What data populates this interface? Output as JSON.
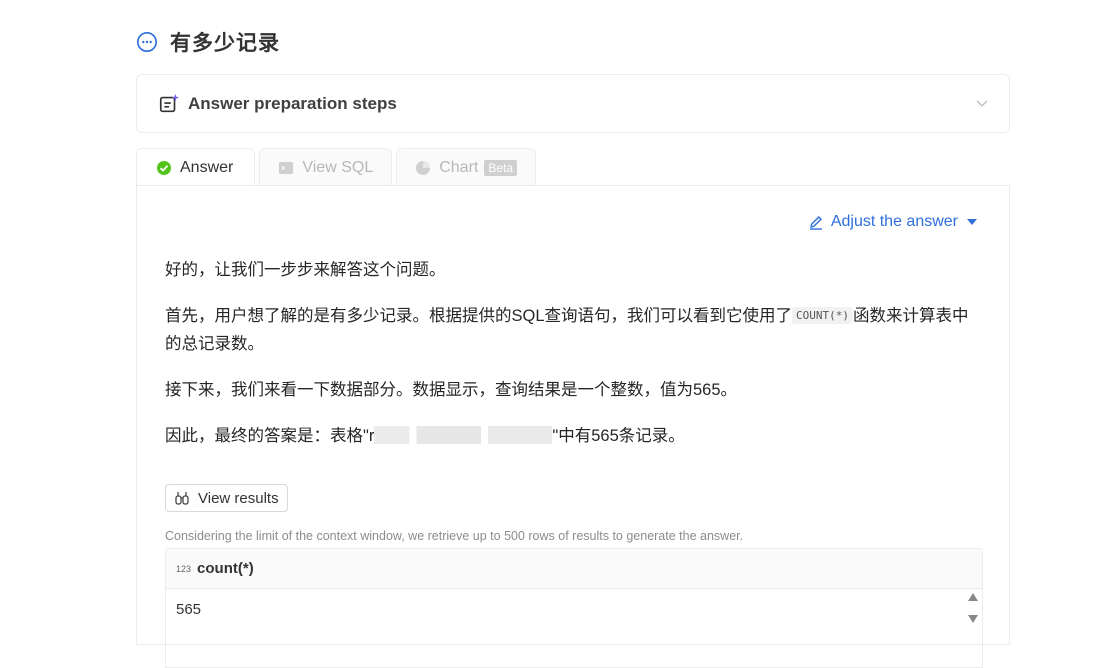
{
  "question": {
    "title": "有多少记录"
  },
  "steps": {
    "label": "Answer preparation steps"
  },
  "tabs": [
    {
      "label": "Answer",
      "icon": "check-circle-icon",
      "active": true
    },
    {
      "label": "View SQL",
      "icon": "terminal-icon",
      "active": false
    },
    {
      "label": "Chart",
      "badge": "Beta",
      "icon": "pie-chart-icon",
      "active": false
    }
  ],
  "adjust": {
    "label": "Adjust the answer"
  },
  "answer": {
    "p1": "好的，让我们一步步来解答这个问题。",
    "p2_before": "首先，用户想了解的是有多少记录。根据提供的SQL查询语句，我们可以看到它使用了",
    "p2_code": "COUNT(*)",
    "p2_after": "函数来计算表中的总记录数。",
    "p3": "接下来，我们来看一下数据部分。数据显示，查询结果是一个整数，值为565。",
    "p4_before": "因此，最终的答案是：表格\"r",
    "p4_after": "\"中有565条记录。"
  },
  "view_results": {
    "label": "View results"
  },
  "limit_note": "Considering the limit of the context window, we retrieve up to 500 rows of results to generate the answer.",
  "table": {
    "column": {
      "type": "123",
      "name": "count(*)"
    },
    "rows": [
      "565"
    ]
  },
  "colors": {
    "accent": "#2f6fdc",
    "success": "#52c41a"
  }
}
